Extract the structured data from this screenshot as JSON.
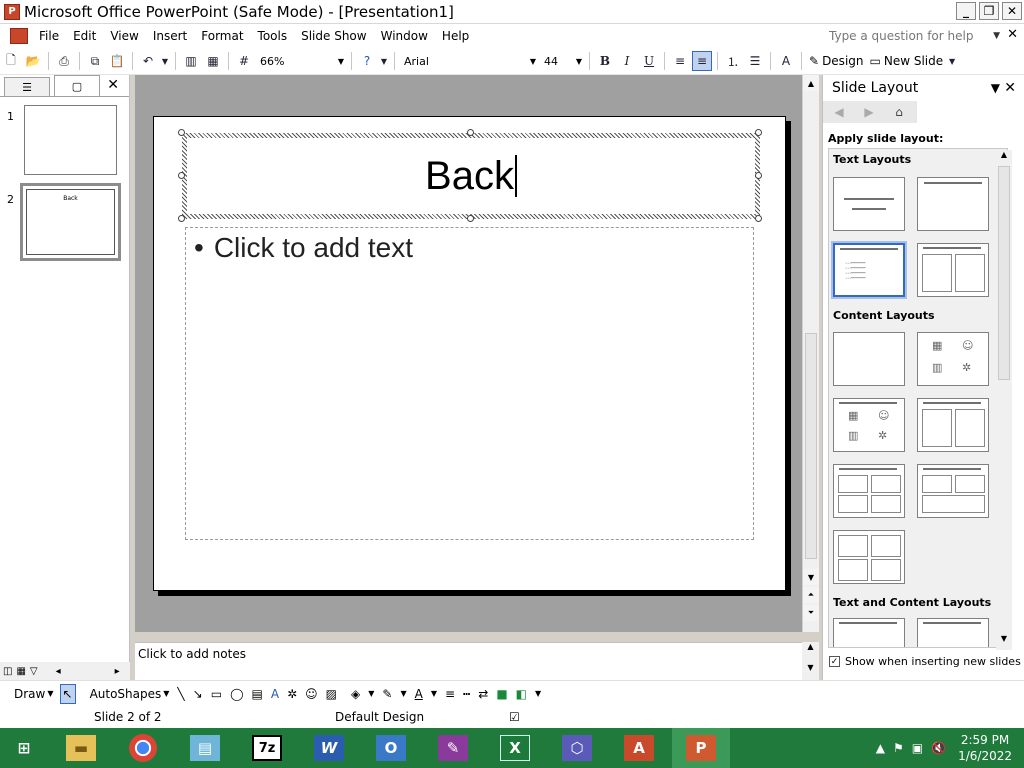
{
  "window": {
    "title": "Microsoft Office PowerPoint (Safe Mode) - [Presentation1]",
    "buttons": [
      "_",
      "❐",
      "✕"
    ]
  },
  "menu": {
    "items": [
      "File",
      "Edit",
      "View",
      "Insert",
      "Format",
      "Tools",
      "Slide Show",
      "Window",
      "Help"
    ],
    "help_placeholder": "Type a question for help"
  },
  "toolbar": {
    "zoom": "66%",
    "font": "Arial",
    "font_size": "44",
    "bold": "B",
    "italic": "I",
    "underline": "U",
    "design": "Design",
    "new_slide": "New Slide"
  },
  "slides_pane": {
    "slides": [
      {
        "number": "1",
        "title": ""
      },
      {
        "number": "2",
        "title": "Back"
      }
    ]
  },
  "slide": {
    "title": "Back",
    "body_placeholder": "Click to add text",
    "bullet": "•"
  },
  "notes": {
    "placeholder": "Click to add notes"
  },
  "task_pane": {
    "title": "Slide Layout",
    "apply_label": "Apply slide layout:",
    "sections": [
      "Text Layouts",
      "Content Layouts",
      "Text and Content Layouts"
    ],
    "show_when_inserting": "Show when inserting new slides",
    "show_checked": true
  },
  "drawing_toolbar": {
    "draw": "Draw",
    "autoshapes": "AutoShapes"
  },
  "status": {
    "slide": "Slide 2 of 2",
    "design": "Default Design"
  },
  "taskbar": {
    "time": "2:59 PM",
    "date": "1/6/2022",
    "apps": [
      "windows-start",
      "file-explorer",
      "chrome",
      "control-panel",
      "7-zip",
      "word",
      "outlook",
      "onenote",
      "excel",
      "visio",
      "access",
      "powerpoint"
    ]
  },
  "colors": {
    "taskbar": "#1f7a3c",
    "selection": "#316ac5",
    "canvas": "#a0a0a0"
  }
}
